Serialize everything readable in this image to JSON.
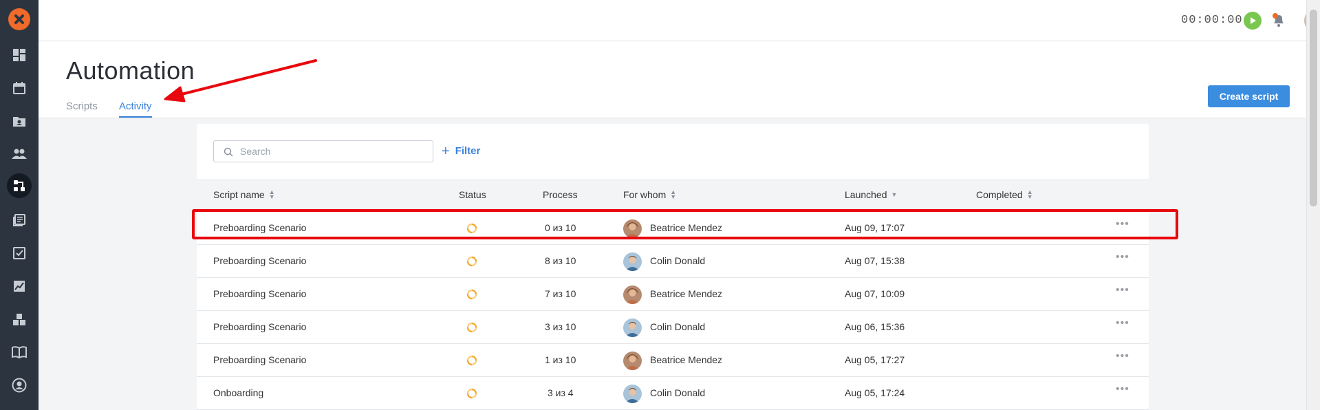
{
  "header": {
    "title": "Automation",
    "tabs": [
      {
        "label": "Scripts"
      },
      {
        "label": "Activity"
      }
    ],
    "create_button": "Create script"
  },
  "topbar": {
    "timer": "00:00:00"
  },
  "toolbar": {
    "search_placeholder": "Search",
    "filter_label": "Filter"
  },
  "table": {
    "columns": [
      "Script name",
      "Status",
      "Process",
      "For whom",
      "Launched",
      "Completed"
    ],
    "rows": [
      {
        "name": "Preboarding Scenario",
        "process": "0 из 10",
        "person": "Beatrice Mendez",
        "launched": "Aug 09, 17:07"
      },
      {
        "name": "Preboarding Scenario",
        "process": "8 из 10",
        "person": "Colin Donald",
        "launched": "Aug 07, 15:38"
      },
      {
        "name": "Preboarding Scenario",
        "process": "7 из 10",
        "person": "Beatrice Mendez",
        "launched": "Aug 07, 10:09"
      },
      {
        "name": "Preboarding Scenario",
        "process": "3 из 10",
        "person": "Colin Donald",
        "launched": "Aug 06, 15:36"
      },
      {
        "name": "Preboarding Scenario",
        "process": "1 из 10",
        "person": "Beatrice Mendez",
        "launched": "Aug 05, 17:27"
      },
      {
        "name": "Onboarding",
        "process": "3 из 4",
        "person": "Colin Donald",
        "launched": "Aug 05, 17:24"
      }
    ]
  },
  "colors": {
    "accent": "#3b82d8",
    "status": "#f5a623",
    "highlight": "#e8080e",
    "sidebar": "#2c3440"
  }
}
